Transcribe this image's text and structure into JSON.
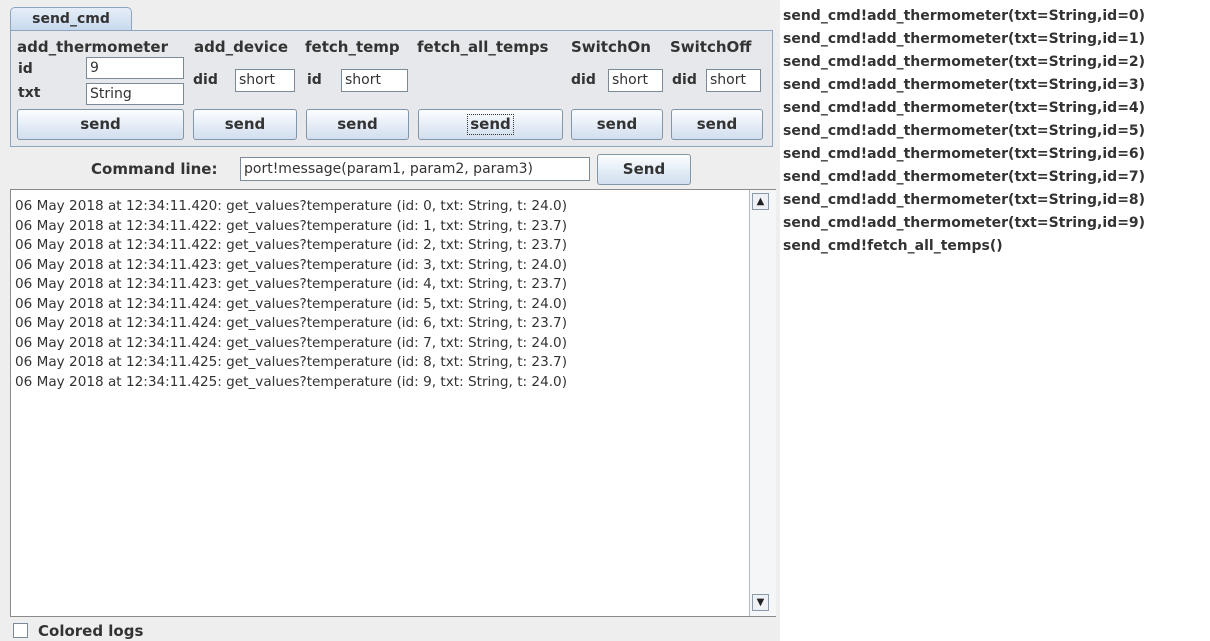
{
  "tab": {
    "label": "send_cmd"
  },
  "commands": [
    {
      "name": "add_thermometer",
      "fields": [
        {
          "label": "id",
          "value": "9"
        },
        {
          "label": "txt",
          "value": "String"
        }
      ],
      "button": "send"
    },
    {
      "name": "add_device",
      "fields": [
        {
          "label": "did",
          "value": "short"
        }
      ],
      "button": "send"
    },
    {
      "name": "fetch_temp",
      "fields": [
        {
          "label": "id",
          "value": "short"
        }
      ],
      "button": "send"
    },
    {
      "name": "fetch_all_temps",
      "fields": [],
      "button": "send"
    },
    {
      "name": "SwitchOn",
      "fields": [
        {
          "label": "did",
          "value": "short"
        }
      ],
      "button": "send"
    },
    {
      "name": "SwitchOff",
      "fields": [
        {
          "label": "did",
          "value": "short"
        }
      ],
      "button": "send"
    }
  ],
  "command_line": {
    "label": "Command line:",
    "value": "port!message(param1, param2, param3)",
    "button": "Send"
  },
  "log": [
    "06 May 2018 at 12:34:11.420: get_values?temperature (id: 0, txt: String, t: 24.0)",
    "06 May 2018 at 12:34:11.422: get_values?temperature (id: 1, txt: String, t: 23.7)",
    "06 May 2018 at 12:34:11.422: get_values?temperature (id: 2, txt: String, t: 23.7)",
    "06 May 2018 at 12:34:11.423: get_values?temperature (id: 3, txt: String, t: 24.0)",
    "06 May 2018 at 12:34:11.423: get_values?temperature (id: 4, txt: String, t: 23.7)",
    "06 May 2018 at 12:34:11.424: get_values?temperature (id: 5, txt: String, t: 24.0)",
    "06 May 2018 at 12:34:11.424: get_values?temperature (id: 6, txt: String, t: 23.7)",
    "06 May 2018 at 12:34:11.424: get_values?temperature (id: 7, txt: String, t: 24.0)",
    "06 May 2018 at 12:34:11.425: get_values?temperature (id: 8, txt: String, t: 23.7)",
    "06 May 2018 at 12:34:11.425: get_values?temperature (id: 9, txt: String, t: 24.0)"
  ],
  "scrollbar": {
    "up_icon": "▲",
    "down_icon": "▼"
  },
  "colored_logs": {
    "label": "Colored logs",
    "checked": false
  },
  "history": [
    "send_cmd!add_thermometer(txt=String,id=0)",
    "send_cmd!add_thermometer(txt=String,id=1)",
    "send_cmd!add_thermometer(txt=String,id=2)",
    "send_cmd!add_thermometer(txt=String,id=3)",
    "send_cmd!add_thermometer(txt=String,id=4)",
    "send_cmd!add_thermometer(txt=String,id=5)",
    "send_cmd!add_thermometer(txt=String,id=6)",
    "send_cmd!add_thermometer(txt=String,id=7)",
    "send_cmd!add_thermometer(txt=String,id=8)",
    "send_cmd!add_thermometer(txt=String,id=9)",
    "send_cmd!fetch_all_temps()"
  ]
}
